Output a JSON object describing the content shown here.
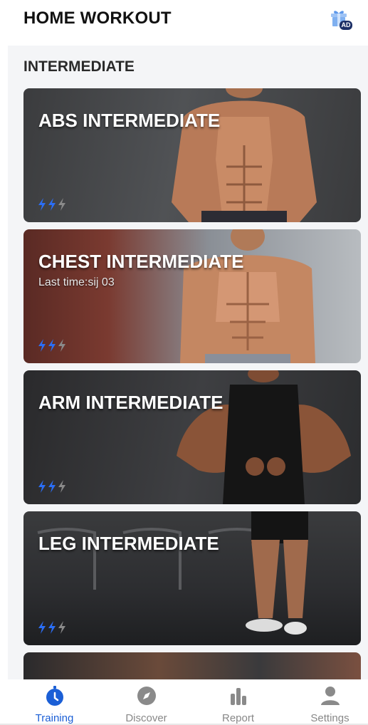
{
  "header": {
    "title": "HOME WORKOUT",
    "ad_badge": "AD"
  },
  "section": {
    "title": "INTERMEDIATE"
  },
  "cards": [
    {
      "title": "ABS INTERMEDIATE",
      "subtitle": "",
      "level_filled": 2,
      "level_total": 3
    },
    {
      "title": "CHEST INTERMEDIATE",
      "subtitle": "Last time:sij 03",
      "level_filled": 2,
      "level_total": 3
    },
    {
      "title": "ARM INTERMEDIATE",
      "subtitle": "",
      "level_filled": 2,
      "level_total": 3
    },
    {
      "title": "LEG INTERMEDIATE",
      "subtitle": "",
      "level_filled": 2,
      "level_total": 3
    }
  ],
  "nav": {
    "items": [
      {
        "label": "Training",
        "icon": "stopwatch-icon",
        "active": true
      },
      {
        "label": "Discover",
        "icon": "compass-icon",
        "active": false
      },
      {
        "label": "Report",
        "icon": "bar-chart-icon",
        "active": false
      },
      {
        "label": "Settings",
        "icon": "user-icon",
        "active": false
      }
    ]
  },
  "colors": {
    "accent": "#1b5fd6",
    "bolt_filled": "#2b6ef5",
    "bolt_empty": "#8a8a8a",
    "nav_inactive": "#888888"
  }
}
